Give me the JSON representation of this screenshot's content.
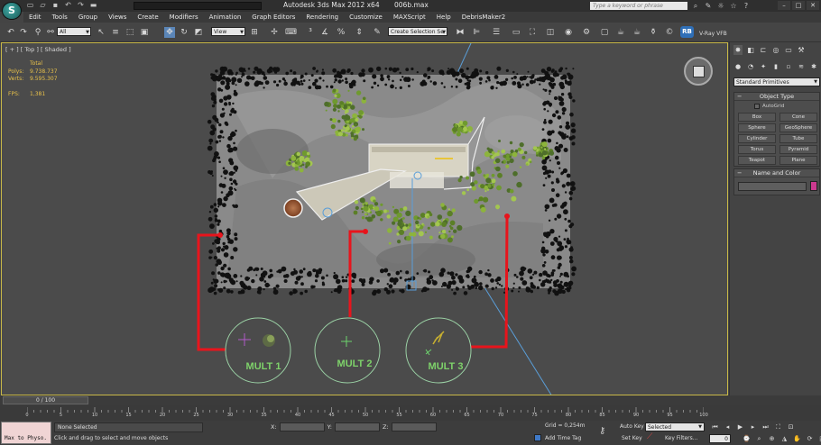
{
  "app": {
    "logo_letter": "S",
    "title": "Autodesk 3ds Max  2012 x64",
    "file_name": "006b.max",
    "search_placeholder": "Type a keyword or phrase",
    "workspace_value": ""
  },
  "menu": [
    "Edit",
    "Tools",
    "Group",
    "Views",
    "Create",
    "Modifiers",
    "Animation",
    "Graph Editors",
    "Rendering",
    "Customize",
    "MAXScript",
    "Help",
    "DebrisMaker2"
  ],
  "toolbar": {
    "filter_value": "All",
    "ref_coord_value": "View",
    "named_selection_value": "Create Selection Se",
    "rb_label": "RB",
    "vray_label": "V-Ray VFB"
  },
  "viewport": {
    "label": "[ + ] [ Top ] [ Shaded ]",
    "stats": {
      "total_label": "Total",
      "polys_label": "Polys:",
      "polys_value": "9.738.737",
      "verts_label": "Verts:",
      "verts_value": "9.595.307",
      "fps_label": "FPS:",
      "fps_value": "1,381"
    },
    "groups": [
      {
        "label": "MULT 1"
      },
      {
        "label": "MULT 2"
      },
      {
        "label": "MULT 3"
      }
    ],
    "colors": {
      "frame": "#c8b848",
      "arrow": "#e8141c",
      "circle": "#9ad0a4",
      "label": "#7ed26a",
      "gizmo_line": "#5a9ed8"
    }
  },
  "command_panel": {
    "primitive_type": "Standard Primitives",
    "object_type_title": "Object Type",
    "autogrid_label": "AutoGrid",
    "primitives": [
      "Box",
      "Cone",
      "Sphere",
      "GeoSphere",
      "Cylinder",
      "Tube",
      "Torus",
      "Pyramid",
      "Teapot",
      "Plane"
    ],
    "name_color_title": "Name and Color",
    "object_color": "#cc3a8f"
  },
  "timeline": {
    "position": "0 / 100",
    "ticks": [
      "0",
      "5",
      "10",
      "15",
      "20",
      "25",
      "30",
      "35",
      "40",
      "45",
      "50",
      "55",
      "60",
      "65",
      "70",
      "75",
      "80",
      "85",
      "90",
      "95",
      "100"
    ]
  },
  "status": {
    "listener_text": "Max to Physo.",
    "selection_status": "None Selected",
    "prompt": "Click and drag to select and move objects",
    "x_label": "X:",
    "y_label": "Y:",
    "z_label": "Z:",
    "grid": "Grid = 0,254m",
    "add_time_tag": "Add Time Tag",
    "auto_key": "Auto Key",
    "set_key": "Set Key",
    "selected_value": "Selected",
    "key_filters": "Key Filters...",
    "frame_value": "0"
  }
}
